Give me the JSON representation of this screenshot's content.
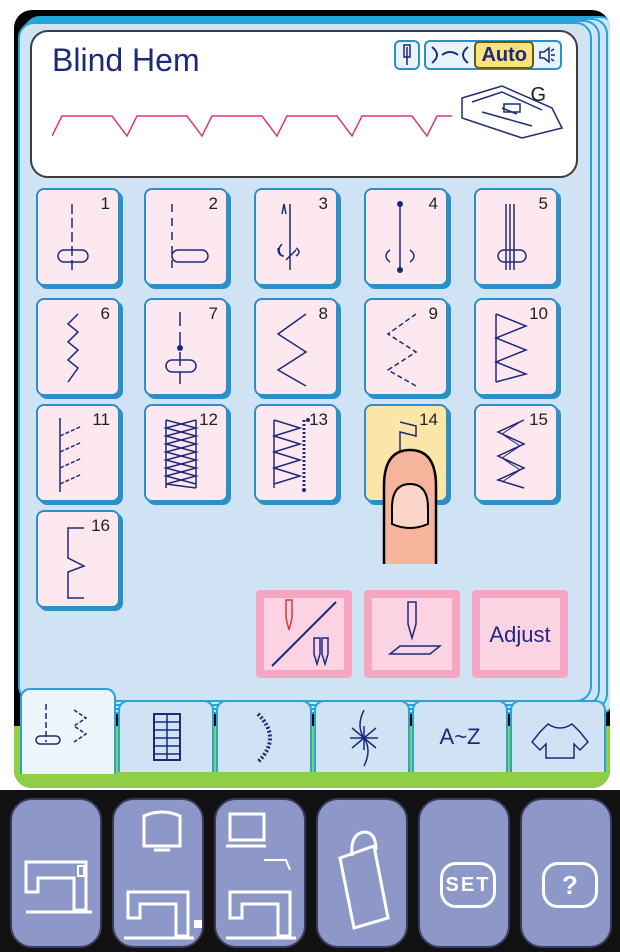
{
  "header": {
    "title": "Blind Hem",
    "auto_label": "Auto",
    "foot_letter": "G",
    "icons": [
      "needle-icon",
      "thread-tension-icon",
      "speaker-icon",
      "presser-foot-icon"
    ]
  },
  "stitches": [
    {
      "num": "1",
      "icon": "straight-stitch-center-icon"
    },
    {
      "num": "2",
      "icon": "straight-stitch-left-icon"
    },
    {
      "num": "3",
      "icon": "lock-stitch-icon"
    },
    {
      "num": "4",
      "icon": "tacking-stitch-icon"
    },
    {
      "num": "5",
      "icon": "triple-stitch-icon"
    },
    {
      "num": "6",
      "icon": "stretch-stitch-icon"
    },
    {
      "num": "7",
      "icon": "basting-stitch-icon"
    },
    {
      "num": "8",
      "icon": "zigzag-stitch-icon"
    },
    {
      "num": "9",
      "icon": "multi-zigzag-icon"
    },
    {
      "num": "10",
      "icon": "overcast-stitch-icon"
    },
    {
      "num": "11",
      "icon": "overedge-stitch-icon"
    },
    {
      "num": "12",
      "icon": "double-overedge-icon"
    },
    {
      "num": "13",
      "icon": "knit-stitch-icon"
    },
    {
      "num": "14",
      "icon": "blind-hem-icon"
    },
    {
      "num": "15",
      "icon": "triple-zigzag-icon"
    },
    {
      "num": "16",
      "icon": "blind-hem-elastic-icon"
    }
  ],
  "selected_stitch": "14",
  "actions": {
    "adjust_label": "Adjust"
  },
  "tabs": [
    {
      "name": "utility-stitches",
      "label": ""
    },
    {
      "name": "buttonholes",
      "label": ""
    },
    {
      "name": "satin-stitches",
      "label": ""
    },
    {
      "name": "decorative-stitches",
      "label": ""
    },
    {
      "name": "alphabet",
      "label": "A~Z"
    },
    {
      "name": "garment-guide",
      "label": ""
    }
  ],
  "bottom_bar": {
    "set_label": "SET",
    "help_label": "?"
  },
  "colors": {
    "accent": "#25a4d8",
    "panel": "#cfe3f5",
    "button_pink": "#fde8ef",
    "selected": "#fbe6a8",
    "bottom_button": "#8e98c8"
  }
}
